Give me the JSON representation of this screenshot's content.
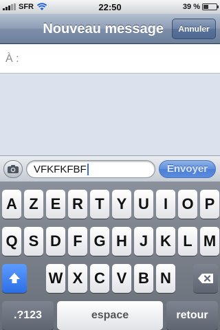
{
  "status_bar": {
    "carrier": "SFR",
    "time": "22:50",
    "battery": "39 %",
    "battery_level": 0.39,
    "icons": [
      "signal-icon",
      "wifi-icon",
      "battery-icon"
    ]
  },
  "nav": {
    "title": "Nouveau message",
    "cancel_label": "Annuler"
  },
  "to_field": {
    "label": "À :",
    "value": ""
  },
  "compose": {
    "text": "VFKFKFBF",
    "send_label": "Envoyer",
    "camera_icon": "camera-icon"
  },
  "keyboard": {
    "row1": [
      "A",
      "Z",
      "E",
      "R",
      "T",
      "Y",
      "U",
      "I",
      "O",
      "P"
    ],
    "row2": [
      "Q",
      "S",
      "D",
      "F",
      "G",
      "H",
      "J",
      "K",
      "L",
      "M"
    ],
    "row3": [
      "W",
      "X",
      "C",
      "V",
      "B",
      "N"
    ],
    "numbers_label": ".?123",
    "space_label": "espace",
    "return_label": "retour",
    "shift_icon": "shift-icon",
    "delete_icon": "delete-icon"
  },
  "colors": {
    "nav_blue": "#7d8fa9",
    "send_blue": "#5a8be0",
    "shift_blue": "#2c6fe6"
  }
}
